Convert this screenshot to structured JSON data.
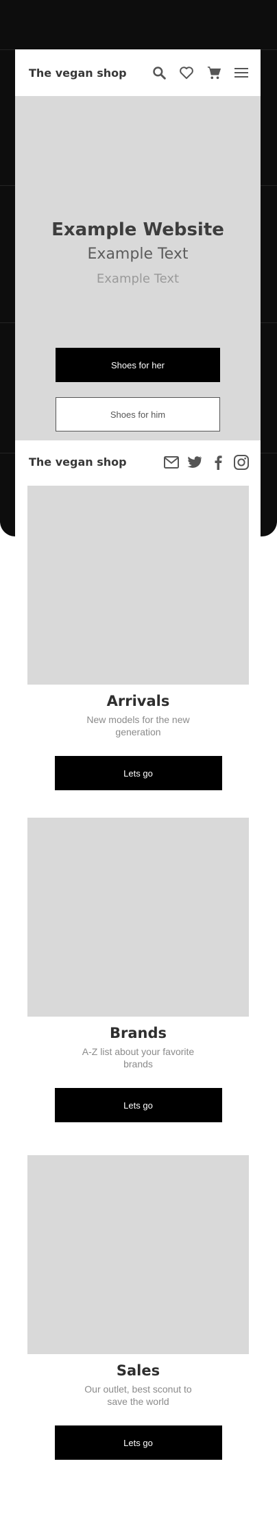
{
  "header": {
    "brand": "The vegan shop"
  },
  "hero": {
    "title": "Example Website",
    "subtitle": "Example Text",
    "subtitle2": "Example Text",
    "button_primary": "Shoes for her",
    "button_secondary": "Shoes for him"
  },
  "footer_bar": {
    "brand": "The vegan shop"
  },
  "cards": [
    {
      "title": "Arrivals",
      "description": "New models for the new generation",
      "button": "Lets go"
    },
    {
      "title": "Brands",
      "description": "A-Z list about your favorite brands",
      "button": "Lets go"
    },
    {
      "title": "Sales",
      "description": "Our outlet, best sconut to save the world",
      "button": "Lets go"
    }
  ],
  "icons": [
    "search-icon",
    "heart-icon",
    "cart-icon",
    "menu-icon",
    "mail-icon",
    "twitter-icon",
    "facebook-icon",
    "instagram-icon"
  ],
  "colors": {
    "placeholder": "#d9d9d9",
    "button": "#000000",
    "frame": "#0d0d0d"
  }
}
